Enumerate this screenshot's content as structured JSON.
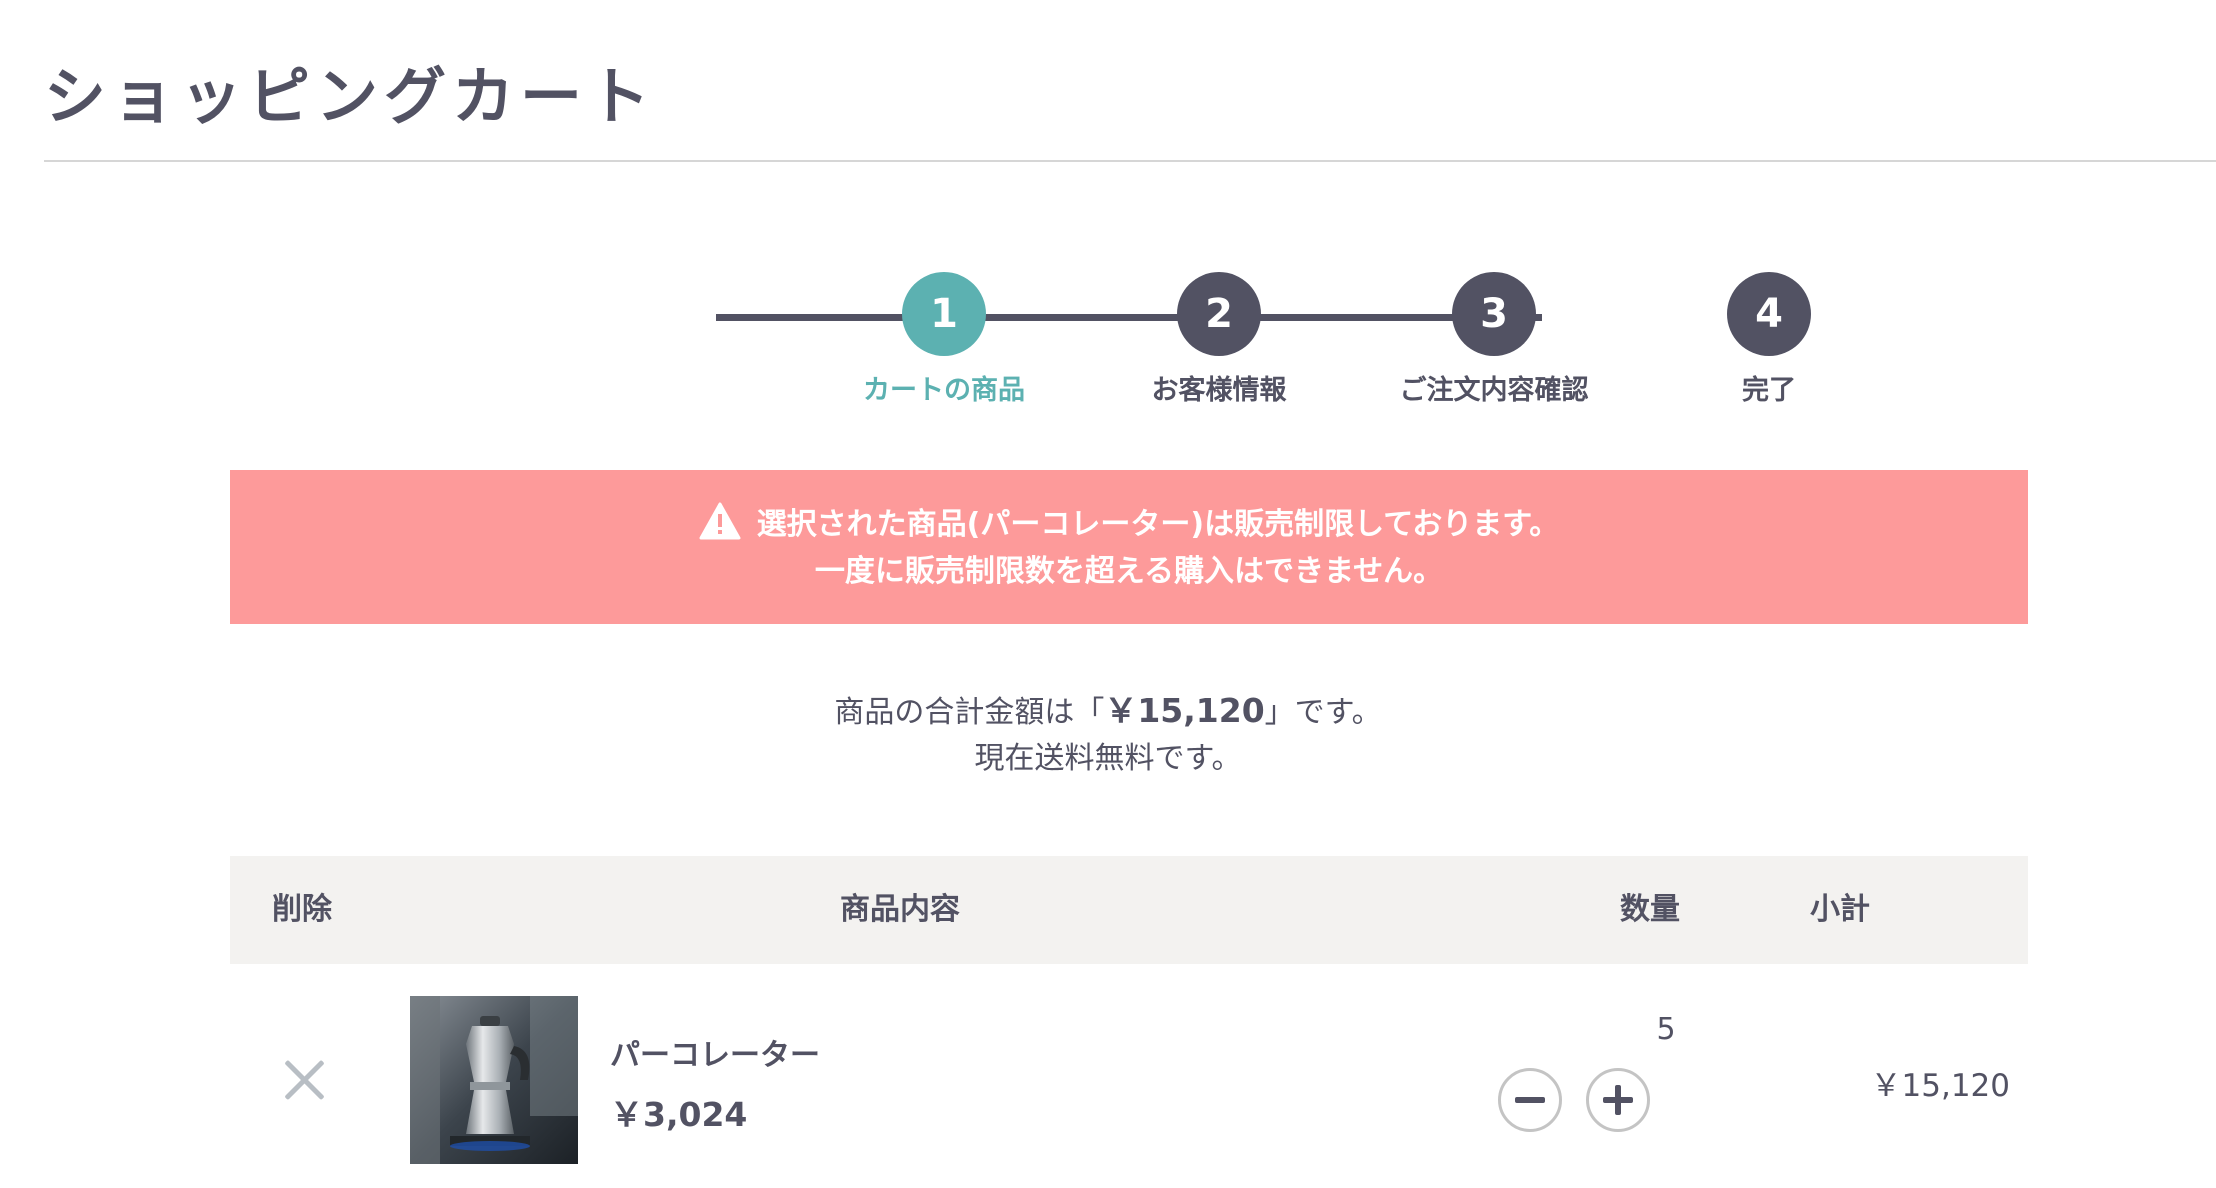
{
  "page": {
    "title": "ショッピングカート"
  },
  "steps": [
    {
      "number": "1",
      "label": "カートの商品",
      "active": true
    },
    {
      "number": "2",
      "label": "お客様情報",
      "active": false
    },
    {
      "number": "3",
      "label": "ご注文内容確認",
      "active": false
    },
    {
      "number": "4",
      "label": "完了",
      "active": false
    }
  ],
  "alert": {
    "icon": "warning-icon",
    "line1": "選択された商品(パーコレーター)は販売制限しております。",
    "line2": "一度に販売制限数を超える購入はできません。"
  },
  "summary": {
    "prefix": "商品の合計金額は「",
    "total": "￥15,120",
    "suffix": "」です。",
    "shipping": "現在送料無料です。"
  },
  "cart_table": {
    "headers": {
      "delete": "削除",
      "item": "商品内容",
      "quantity": "数量",
      "subtotal": "小計"
    },
    "rows": [
      {
        "name": "パーコレーター",
        "price": "￥3,024",
        "quantity": "5",
        "subtotal": "￥15,120",
        "delete_icon": "close-icon",
        "minus_icon": "minus-icon",
        "plus_icon": "plus-icon"
      }
    ]
  },
  "colors": {
    "text": "#525263",
    "accent": "#5cb1b1",
    "alert_bg": "#fd9a9a",
    "header_bg": "#f3f2f0"
  }
}
